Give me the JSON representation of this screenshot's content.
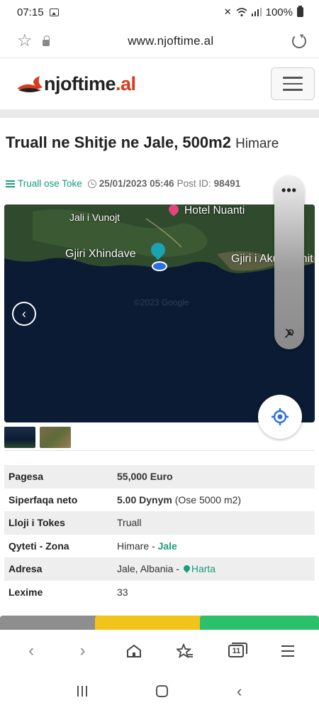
{
  "status_bar": {
    "time": "07:15",
    "battery": "100%"
  },
  "browser": {
    "url": "www.njoftime.al"
  },
  "site": {
    "logo_main": "njoftime",
    "logo_tld": ".al"
  },
  "listing": {
    "title": "Truall ne Shitje ne Jale, 500m2",
    "location": "Himare",
    "category": "Truall ose Toke",
    "date": "25/01/2023 05:46",
    "post_id_label": "Post ID:",
    "post_id": "98491"
  },
  "map": {
    "labels": {
      "hotel": "Hotel Nuanti",
      "jali": "Jali i Vunojt",
      "gjiri_x": "Gjiri Xhindave",
      "gjiri_a": "Gjiri i Akuariumit"
    },
    "watermark": "©2023 Google"
  },
  "details": [
    {
      "key": "Pagesa",
      "value": "55,000 Euro",
      "bold": true
    },
    {
      "key": "Siperfaqa neto",
      "value": "5.00 Dynym",
      "extra": "(Ose 5000 m2)",
      "bold": true
    },
    {
      "key": "Lloji i Tokes",
      "value": "Truall"
    },
    {
      "key": "Qyteti - Zona",
      "value": "Himare - ",
      "link": "Jale"
    },
    {
      "key": "Adresa",
      "value": "Jale, Albania - ",
      "link": "Harta"
    },
    {
      "key": "Lexime",
      "value": "33"
    }
  ],
  "colors": {
    "brand_red": "#d73a1d",
    "accent_green": "#1b9c7a",
    "strip_gray": "#8e8e8e",
    "strip_yellow": "#f2c31b",
    "strip_green": "#2bc16b"
  },
  "icons": {
    "star": "star-icon",
    "lock": "lock-icon",
    "reload": "reload-icon",
    "menu": "hamburger-icon",
    "category": "list-icon",
    "clock": "clock-icon",
    "prev": "chevron-left-icon",
    "locate": "my-location-icon",
    "back": "back-icon",
    "forward": "forward-icon",
    "home": "home-icon",
    "bookmarks": "bookmarks-icon",
    "tabs": "tabs-icon",
    "browser_menu": "menu-icon"
  },
  "toolbar": {
    "tab_count": "11"
  }
}
